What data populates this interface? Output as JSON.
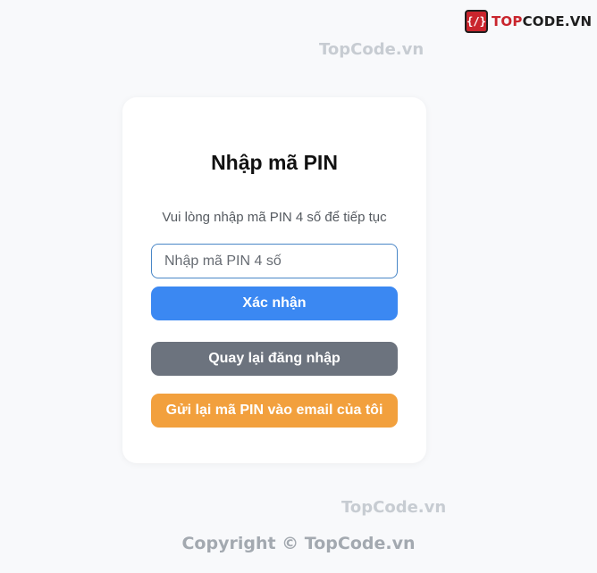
{
  "brand": {
    "logo_mark": "{/}",
    "logo_text": "TOPCODE.VN",
    "watermark": "TopCode.vn",
    "copyright": "Copyright © TopCode.vn"
  },
  "pin_form": {
    "title": "Nhập mã PIN",
    "subtitle": "Vui lòng nhập mã PIN 4 số để tiếp tục",
    "pin_input": {
      "placeholder": "Nhập mã PIN 4 số",
      "value": ""
    },
    "confirm_label": "Xác nhận",
    "back_label": "Quay lại đăng nhập",
    "resend_label": "Gửi lại mã PIN vào email của tôi"
  },
  "colors": {
    "confirm": "#3b88f2",
    "back": "#6c737e",
    "resend": "#f2a03d",
    "logo_red": "#c9252d"
  }
}
